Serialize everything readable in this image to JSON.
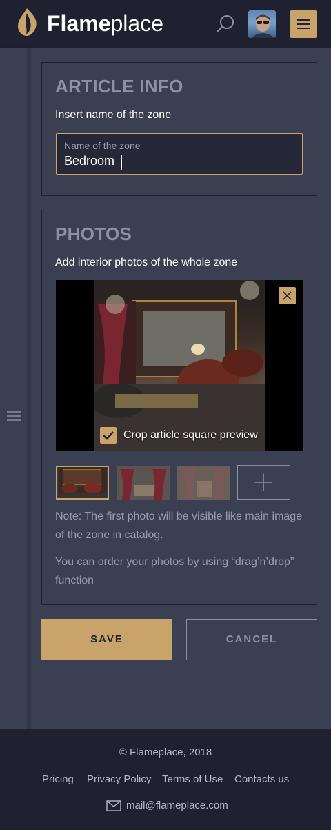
{
  "header": {
    "brand_bold": "Flame",
    "brand_light": "place",
    "icons": [
      "flame-logo-icon",
      "search-icon",
      "user-avatar",
      "hamburger-menu-icon"
    ]
  },
  "article_info": {
    "title": "ARTICLE INFO",
    "subtitle": "Insert name of the zone",
    "field_label": "Name of the zone",
    "field_value": "Bedroom"
  },
  "photos": {
    "title": "PHOTOS",
    "subtitle": "Add interior photos of the whole zone",
    "crop_label": "Crop article square preview",
    "crop_checked": true,
    "note1": "Note: The first photo will be visible like main image of the zone in catalog.",
    "note2": "You can order your photos by using “drag’n’drop” function"
  },
  "actions": {
    "save": "SAVE",
    "cancel": "CANCEL"
  },
  "footer": {
    "copyright": "© Flameplace, 2018",
    "links": [
      "Pricing",
      "Privacy Policy",
      "Terms of Use",
      "Contacts us"
    ],
    "email": "mail@flameplace.com"
  },
  "colors": {
    "accent": "#c8a46b",
    "background": "#3b3f52",
    "header": "#1f2130"
  }
}
